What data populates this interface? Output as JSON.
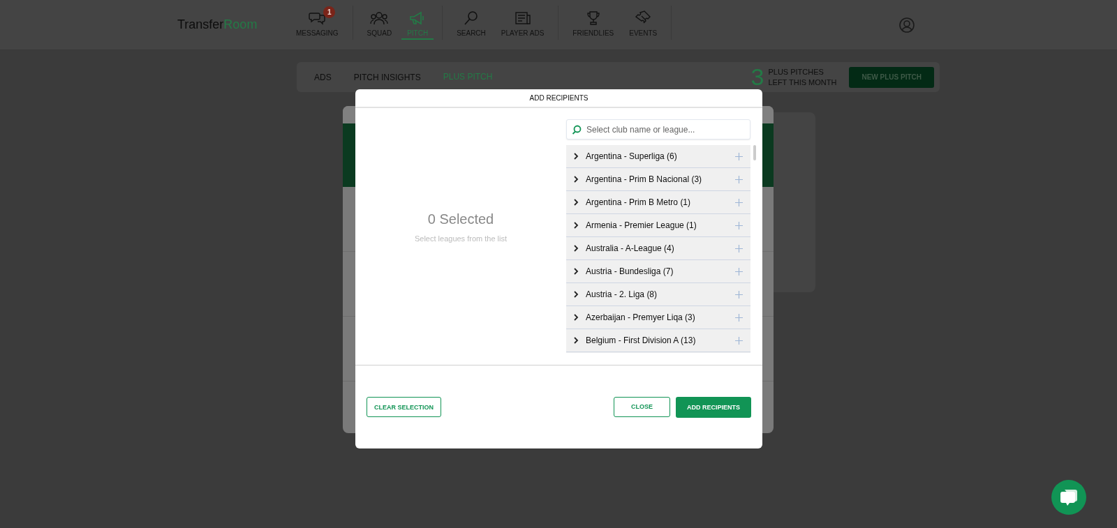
{
  "header": {
    "logo": {
      "first": "Transfer",
      "second": "Room"
    },
    "nav_groups": [
      {
        "items": [
          {
            "label": "MESSAGING",
            "kind": "chat",
            "badge": "1",
            "selected": false
          }
        ]
      },
      {
        "items": [
          {
            "label": "SQUAD",
            "kind": "people",
            "selected": false
          },
          {
            "label": "PITCH",
            "kind": "megaphone",
            "selected": true
          }
        ]
      },
      {
        "items": [
          {
            "label": "SEARCH",
            "kind": "search",
            "selected": false
          },
          {
            "label": "PLAYER ADS",
            "kind": "newspaper",
            "selected": false
          }
        ]
      },
      {
        "items": [
          {
            "label": "FRIENDLIES",
            "kind": "trophy",
            "selected": false
          },
          {
            "label": "EVENTS",
            "kind": "ticket",
            "selected": false
          }
        ]
      }
    ]
  },
  "tabs": [
    {
      "label": "ADS",
      "selected": false
    },
    {
      "label": "PITCH INSIGHTS",
      "selected": false
    },
    {
      "label": "PLUS PITCH",
      "selected": true
    }
  ],
  "plus_pitches": {
    "count": "3",
    "line1": "PLUS PITCHES",
    "line2": "LEFT THIS MONTH",
    "button": "NEW PLUS PITCH"
  },
  "modal": {
    "title": "ADD RECIPIENTS",
    "selected_count": "0 Selected",
    "hint": "Select leagues from the list",
    "search": {
      "placeholder": "Select club name or league..."
    },
    "leagues": [
      {
        "name": "Argentina - Superliga (6)",
        "expanded": false
      },
      {
        "name": "Argentina - Prim B Nacional (3)",
        "expanded": false
      },
      {
        "name": "Argentina - Prim B Metro (1)",
        "expanded": false
      },
      {
        "name": "Armenia - Premier League (1)",
        "expanded": false
      },
      {
        "name": "Australia - A-League (4)",
        "expanded": false
      },
      {
        "name": "Austria - Bundesliga (7)",
        "expanded": false
      },
      {
        "name": "Austria - 2. Liga (8)",
        "expanded": false
      },
      {
        "name": "Azerbaijan - Premyer Liqa (3)",
        "expanded": false
      },
      {
        "name": "Belgium - First Division A (13)",
        "expanded": false
      }
    ],
    "clear_button": "CLEAR SELECTION",
    "close_button": "CLOSE",
    "add_button": "ADD RECIPIENTS"
  }
}
